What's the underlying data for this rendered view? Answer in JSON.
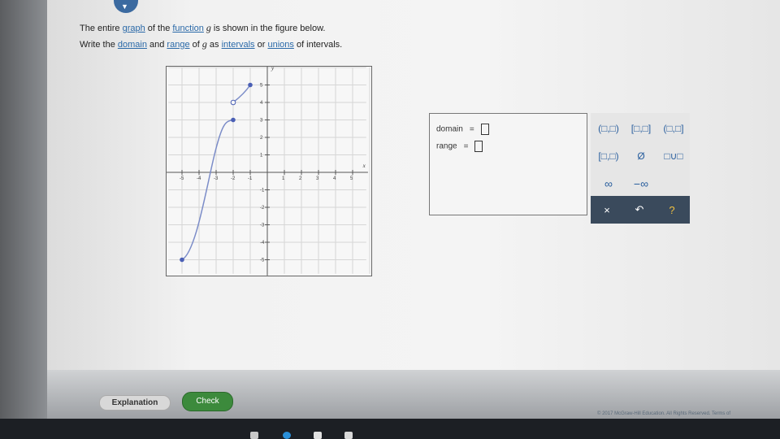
{
  "question": {
    "line1_a": "The entire ",
    "link_graph": "graph",
    "line1_b": " of the ",
    "link_function": "function",
    "line1_var": " g ",
    "line1_c": "is shown in the figure below.",
    "line2_a": "Write the ",
    "link_domain": "domain",
    "line2_b": " and ",
    "link_range": "range",
    "line2_c": " of ",
    "line2_var": "g",
    "line2_d": " as ",
    "link_intervals": "intervals",
    "line2_e": " or ",
    "link_unions": "unions",
    "line2_f": " of intervals."
  },
  "graph": {
    "x_axis_label": "x",
    "y_axis_label": "y",
    "x_tick_labels": [
      "-5",
      "-4",
      "-3",
      "-2",
      "-1",
      "1",
      "2",
      "3",
      "4",
      "5"
    ],
    "y_tick_labels": [
      "5",
      "4",
      "3",
      "2",
      "1",
      "-1",
      "-2",
      "-3",
      "-4",
      "-5"
    ],
    "curve": {
      "closed_points": [
        [
          -5,
          -5
        ],
        [
          -2,
          3
        ],
        [
          -1,
          5
        ]
      ],
      "open_points": [
        [
          -2,
          4
        ]
      ],
      "curve_color": "#7b8cc8",
      "point_color": "#4a5fb5"
    }
  },
  "answer": {
    "domain_label": "domain",
    "range_label": "range",
    "equals": "="
  },
  "palette": {
    "row1": [
      "(□,□)",
      "[□,□]",
      "(□,□]"
    ],
    "row2": [
      "[□,□)",
      "Ø",
      "□∪□"
    ],
    "row3": [
      "∞",
      "−∞"
    ],
    "clear": "×",
    "undo": "↶",
    "help": "?"
  },
  "footer": {
    "explanation_label": "Explanation",
    "check_label": "Check",
    "copyright": "© 2017 McGraw-Hill Education. All Rights Reserved.   Terms of"
  },
  "colors": {
    "link": "#2a69a8",
    "check_button": "#3c8a3c",
    "palette_dark": "#3a4a5c"
  }
}
